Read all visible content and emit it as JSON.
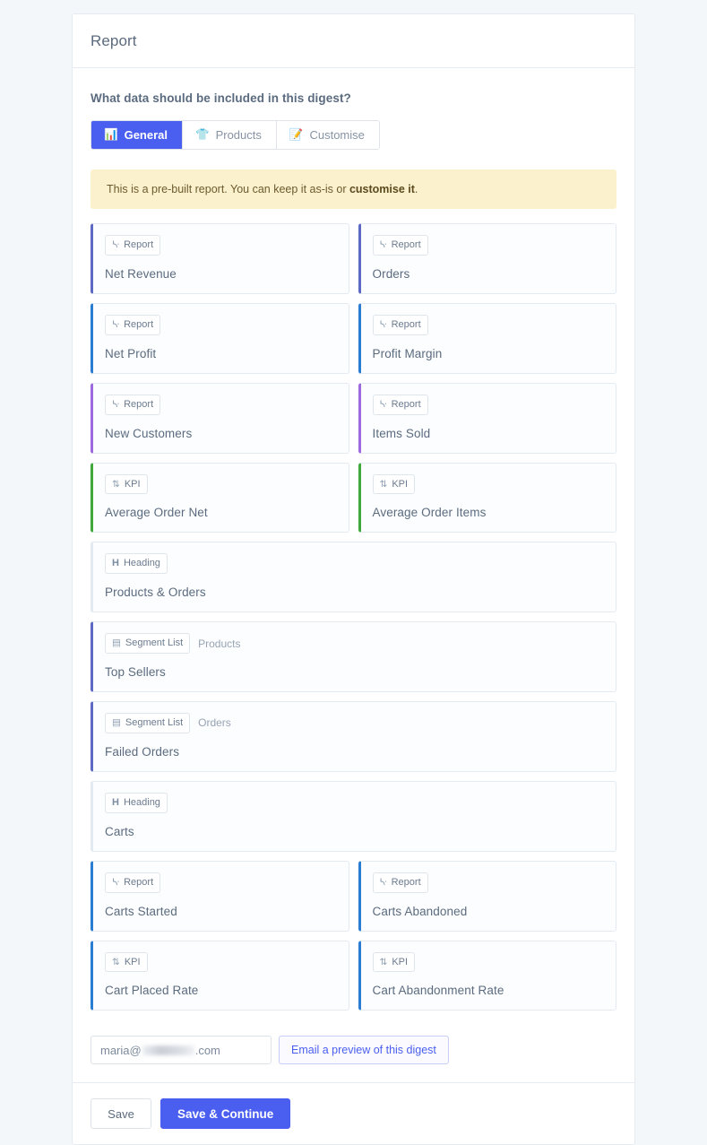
{
  "header": {
    "title": "Report"
  },
  "form": {
    "question": "What data should be included in this digest?",
    "tabs": [
      {
        "label": "General",
        "icon": "bar-chart-icon",
        "glyph": "📊",
        "active": true
      },
      {
        "label": "Products",
        "icon": "tshirt-icon",
        "glyph": "👕",
        "active": false
      },
      {
        "label": "Customise",
        "icon": "memo-icon",
        "glyph": "📝",
        "active": false
      }
    ],
    "notice": {
      "text_before": "This is a pre-built report. You can keep it as-is or ",
      "link_text": "customise it",
      "text_after": "."
    }
  },
  "colors": {
    "accent": "#4a5ef0",
    "indigo": "#5c6ac4",
    "blue": "#2b7dd1",
    "purple": "#9c6ade",
    "green": "#3fa93b",
    "notice_bg": "#fcf1cd",
    "page_bg": "#f4f7fa"
  },
  "blocks": [
    {
      "layout": "pair",
      "items": [
        {
          "badge": "Report",
          "icon": "chart-icon",
          "glyph": "ᔁ",
          "title": "Net Revenue",
          "accent": "#5c6ac4",
          "sub": ""
        },
        {
          "badge": "Report",
          "icon": "chart-icon",
          "glyph": "ᔁ",
          "title": "Orders",
          "accent": "#5c6ac4",
          "sub": ""
        }
      ]
    },
    {
      "layout": "pair",
      "items": [
        {
          "badge": "Report",
          "icon": "chart-icon",
          "glyph": "ᔁ",
          "title": "Net Profit",
          "accent": "#2b7dd1",
          "sub": ""
        },
        {
          "badge": "Report",
          "icon": "chart-icon",
          "glyph": "ᔁ",
          "title": "Profit Margin",
          "accent": "#2b7dd1",
          "sub": ""
        }
      ]
    },
    {
      "layout": "pair",
      "items": [
        {
          "badge": "Report",
          "icon": "chart-icon",
          "glyph": "ᔁ",
          "title": "New Customers",
          "accent": "#9c6ade",
          "sub": ""
        },
        {
          "badge": "Report",
          "icon": "chart-icon",
          "glyph": "ᔁ",
          "title": "Items Sold",
          "accent": "#9c6ade",
          "sub": ""
        }
      ]
    },
    {
      "layout": "pair",
      "items": [
        {
          "badge": "KPI",
          "icon": "sort-arrows-icon",
          "glyph": "⇅",
          "title": "Average Order Net",
          "accent": "#3fa93b",
          "sub": ""
        },
        {
          "badge": "KPI",
          "icon": "sort-arrows-icon",
          "glyph": "⇅",
          "title": "Average Order Items",
          "accent": "#3fa93b",
          "sub": ""
        }
      ]
    },
    {
      "layout": "full",
      "items": [
        {
          "badge": "Heading",
          "icon": "heading-icon",
          "glyph": "H",
          "title": "Products & Orders",
          "accent": "#e3eaf2",
          "sub": ""
        }
      ]
    },
    {
      "layout": "full",
      "items": [
        {
          "badge": "Segment List",
          "icon": "table-icon",
          "glyph": "▤",
          "title": "Top Sellers",
          "accent": "#5c6ac4",
          "sub": "Products"
        }
      ]
    },
    {
      "layout": "full",
      "items": [
        {
          "badge": "Segment List",
          "icon": "table-icon",
          "glyph": "▤",
          "title": "Failed Orders",
          "accent": "#5c6ac4",
          "sub": "Orders"
        }
      ]
    },
    {
      "layout": "full",
      "items": [
        {
          "badge": "Heading",
          "icon": "heading-icon",
          "glyph": "H",
          "title": "Carts",
          "accent": "#e3eaf2",
          "sub": ""
        }
      ]
    },
    {
      "layout": "pair",
      "items": [
        {
          "badge": "Report",
          "icon": "chart-icon",
          "glyph": "ᔁ",
          "title": "Carts Started",
          "accent": "#2b7dd1",
          "sub": ""
        },
        {
          "badge": "Report",
          "icon": "chart-icon",
          "glyph": "ᔁ",
          "title": "Carts Abandoned",
          "accent": "#2b7dd1",
          "sub": ""
        }
      ]
    },
    {
      "layout": "pair",
      "items": [
        {
          "badge": "KPI",
          "icon": "sort-arrows-icon",
          "glyph": "⇅",
          "title": "Cart Placed Rate",
          "accent": "#2b7dd1",
          "sub": ""
        },
        {
          "badge": "KPI",
          "icon": "sort-arrows-icon",
          "glyph": "⇅",
          "title": "Cart Abandonment Rate",
          "accent": "#2b7dd1",
          "sub": ""
        }
      ]
    }
  ],
  "email": {
    "value_prefix": "maria@",
    "value_suffix": ".com",
    "preview_button": "Email a preview of this digest"
  },
  "footer": {
    "save_label": "Save",
    "save_continue_label": "Save & Continue"
  }
}
